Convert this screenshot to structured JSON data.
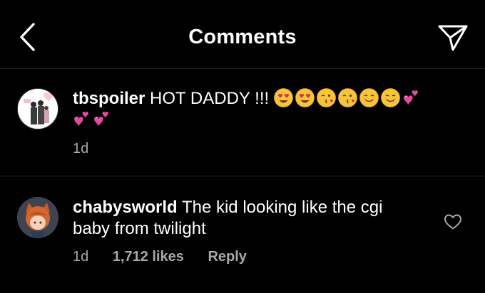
{
  "header": {
    "title": "Comments",
    "back_icon": "chevron-left-icon",
    "share_icon": "paper-plane-icon"
  },
  "caption": {
    "username": "tbspoiler",
    "text": "HOT DADDY !!!",
    "emojis": [
      "heart-eyes",
      "heart-eyes",
      "kissing-heart",
      "kissing-heart",
      "yum",
      "yum",
      "two-hearts",
      "two-hearts",
      "two-hearts"
    ],
    "time": "1d"
  },
  "comment": {
    "username": "chabysworld",
    "text": "The kid looking like the cgi baby from twilight",
    "time": "1d",
    "likes": "1,712 likes",
    "reply": "Reply",
    "like_icon": "heart-outline-icon"
  },
  "colors": {
    "background": "#000000",
    "text": "#ffffff",
    "muted": "#a8a8a8",
    "divider": "#262626",
    "emoji_yellow": "#f7c235",
    "emoji_heart": "#e64aa0"
  }
}
